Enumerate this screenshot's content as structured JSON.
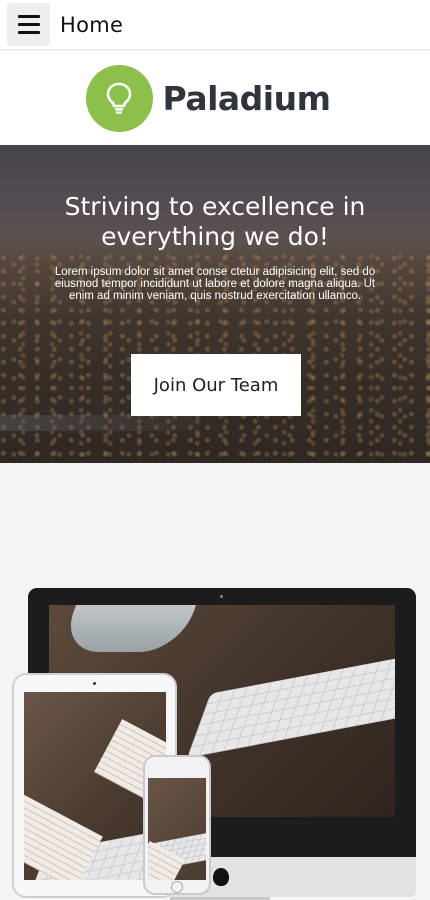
{
  "topbar": {
    "title": "Home",
    "menu_icon": "hamburger-menu-icon"
  },
  "brand": {
    "name": "Paladium",
    "logo_icon": "lightbulb-icon",
    "logo_color": "#8cc04b"
  },
  "hero": {
    "title": "Striving to excellence in everything we do!",
    "text": "Lorem ipsum dolor sit amet conse ctetur adipisicing elit, sed do eiusmod tempor incididunt ut labore et dolore magna aliqua. Ut enim ad minim veniam, quis nostrud exercitation ullamco.",
    "button_label": "Join Our Team"
  },
  "devices": {
    "apple_icon": "apple-logo-icon"
  }
}
